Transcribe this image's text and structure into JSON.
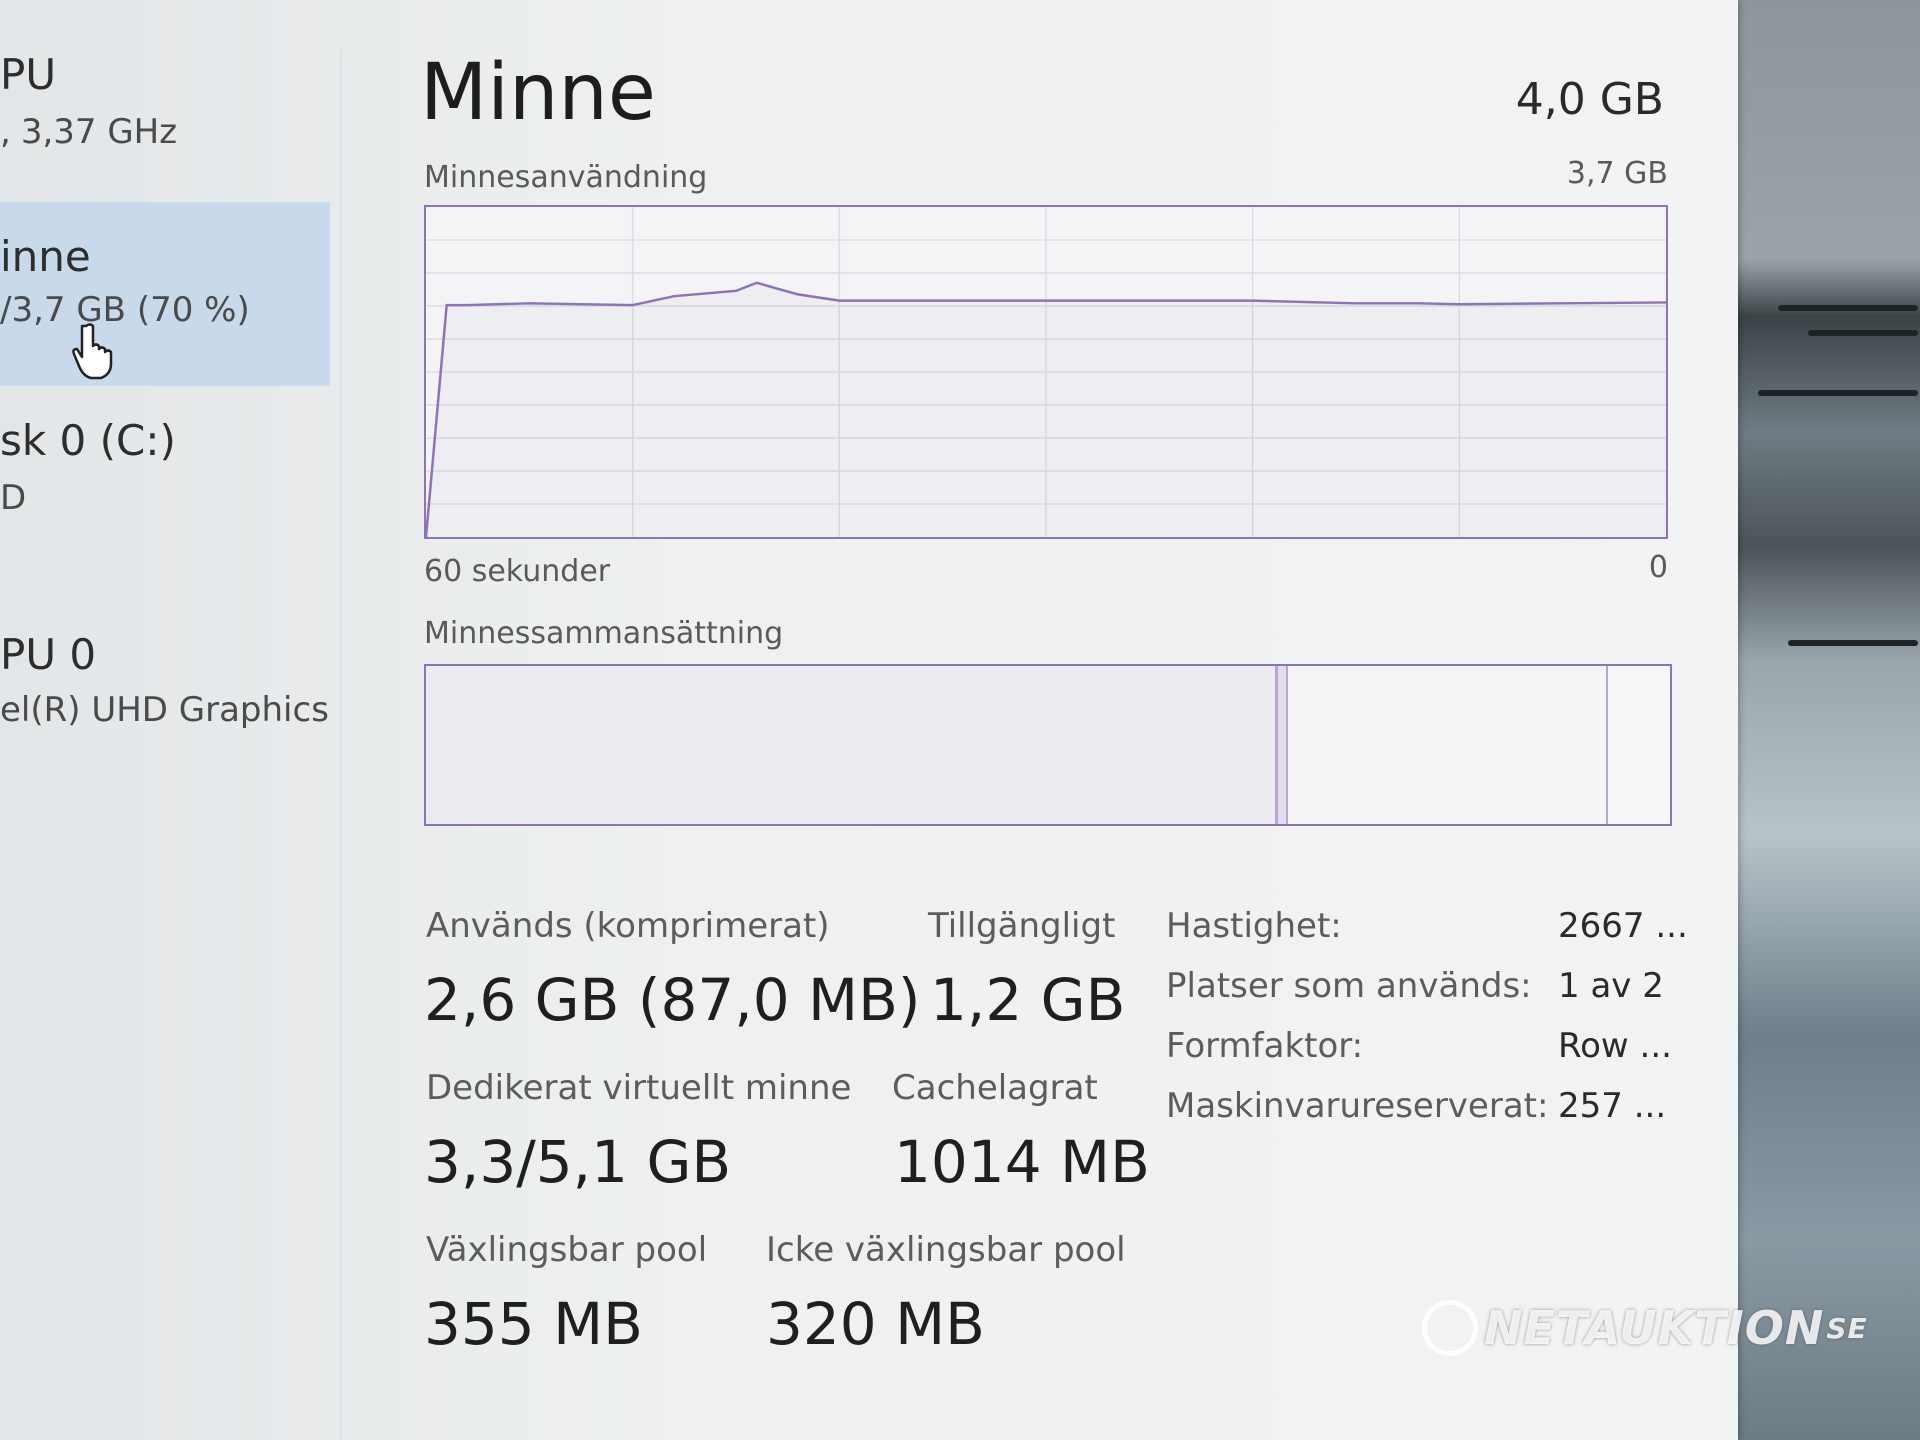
{
  "sidebar": {
    "items": [
      {
        "title": "PU",
        "subtitle": "3,37 GHz",
        "subtitle_prefix": "",
        "selected": false
      },
      {
        "title": "inne",
        "subtitle": "/3,7 GB (70 %)",
        "selected": true
      },
      {
        "title": "sk 0 (C:)",
        "subtitle": "D",
        "selected": false
      },
      {
        "title": "PU 0",
        "subtitle": "el(R) UHD Graphics",
        "selected": false
      }
    ]
  },
  "main": {
    "title": "Minne",
    "total": "4,0 GB",
    "usage_graph": {
      "label": "Minnesanvändning",
      "max_label": "3,7 GB",
      "time_left_label": "60 sekunder",
      "time_right_label": "0"
    },
    "composition": {
      "label": "Minnessammansättning"
    },
    "stats": {
      "used_label": "Används (komprimerat)",
      "used_value": "2,6 GB (87,0 MB)",
      "available_label": "Tillgängligt",
      "available_value": "1,2 GB",
      "committed_label": "Dedikerat virtuellt minne",
      "committed_value": "3,3/5,1 GB",
      "cached_label": "Cachelagrat",
      "cached_value": "1014 MB",
      "paged_label": "Växlingsbar pool",
      "paged_value": "355 MB",
      "nonpaged_label": "Icke växlingsbar pool",
      "nonpaged_value": "320 MB"
    },
    "details": [
      {
        "label": "Hastighet:",
        "value": "2667 ..."
      },
      {
        "label": "Platser som används:",
        "value": "1 av 2"
      },
      {
        "label": "Formfaktor:",
        "value": "Row ..."
      },
      {
        "label": "Maskinvarureserverat:",
        "value": "257 ..."
      }
    ]
  },
  "watermark": {
    "brand": "NETAUKTION",
    "tld": "SE"
  },
  "colors": {
    "accent": "#8e74b5",
    "selected": "#c7d9ea"
  },
  "chart_data": {
    "type": "line",
    "title": "Minnesanvändning",
    "x_range": [
      60,
      0
    ],
    "ylim": [
      0,
      3.7
    ],
    "series": [
      {
        "x": [
          60,
          59,
          58,
          55,
          50,
          48,
          45,
          44,
          42,
          40,
          35,
          30,
          25,
          20,
          15,
          12,
          10,
          5,
          0
        ],
        "values": [
          0.0,
          2.6,
          2.6,
          2.62,
          2.6,
          2.7,
          2.76,
          2.85,
          2.72,
          2.65,
          2.65,
          2.65,
          2.65,
          2.65,
          2.62,
          2.62,
          2.61,
          2.62,
          2.63
        ]
      }
    ],
    "grid": true
  }
}
